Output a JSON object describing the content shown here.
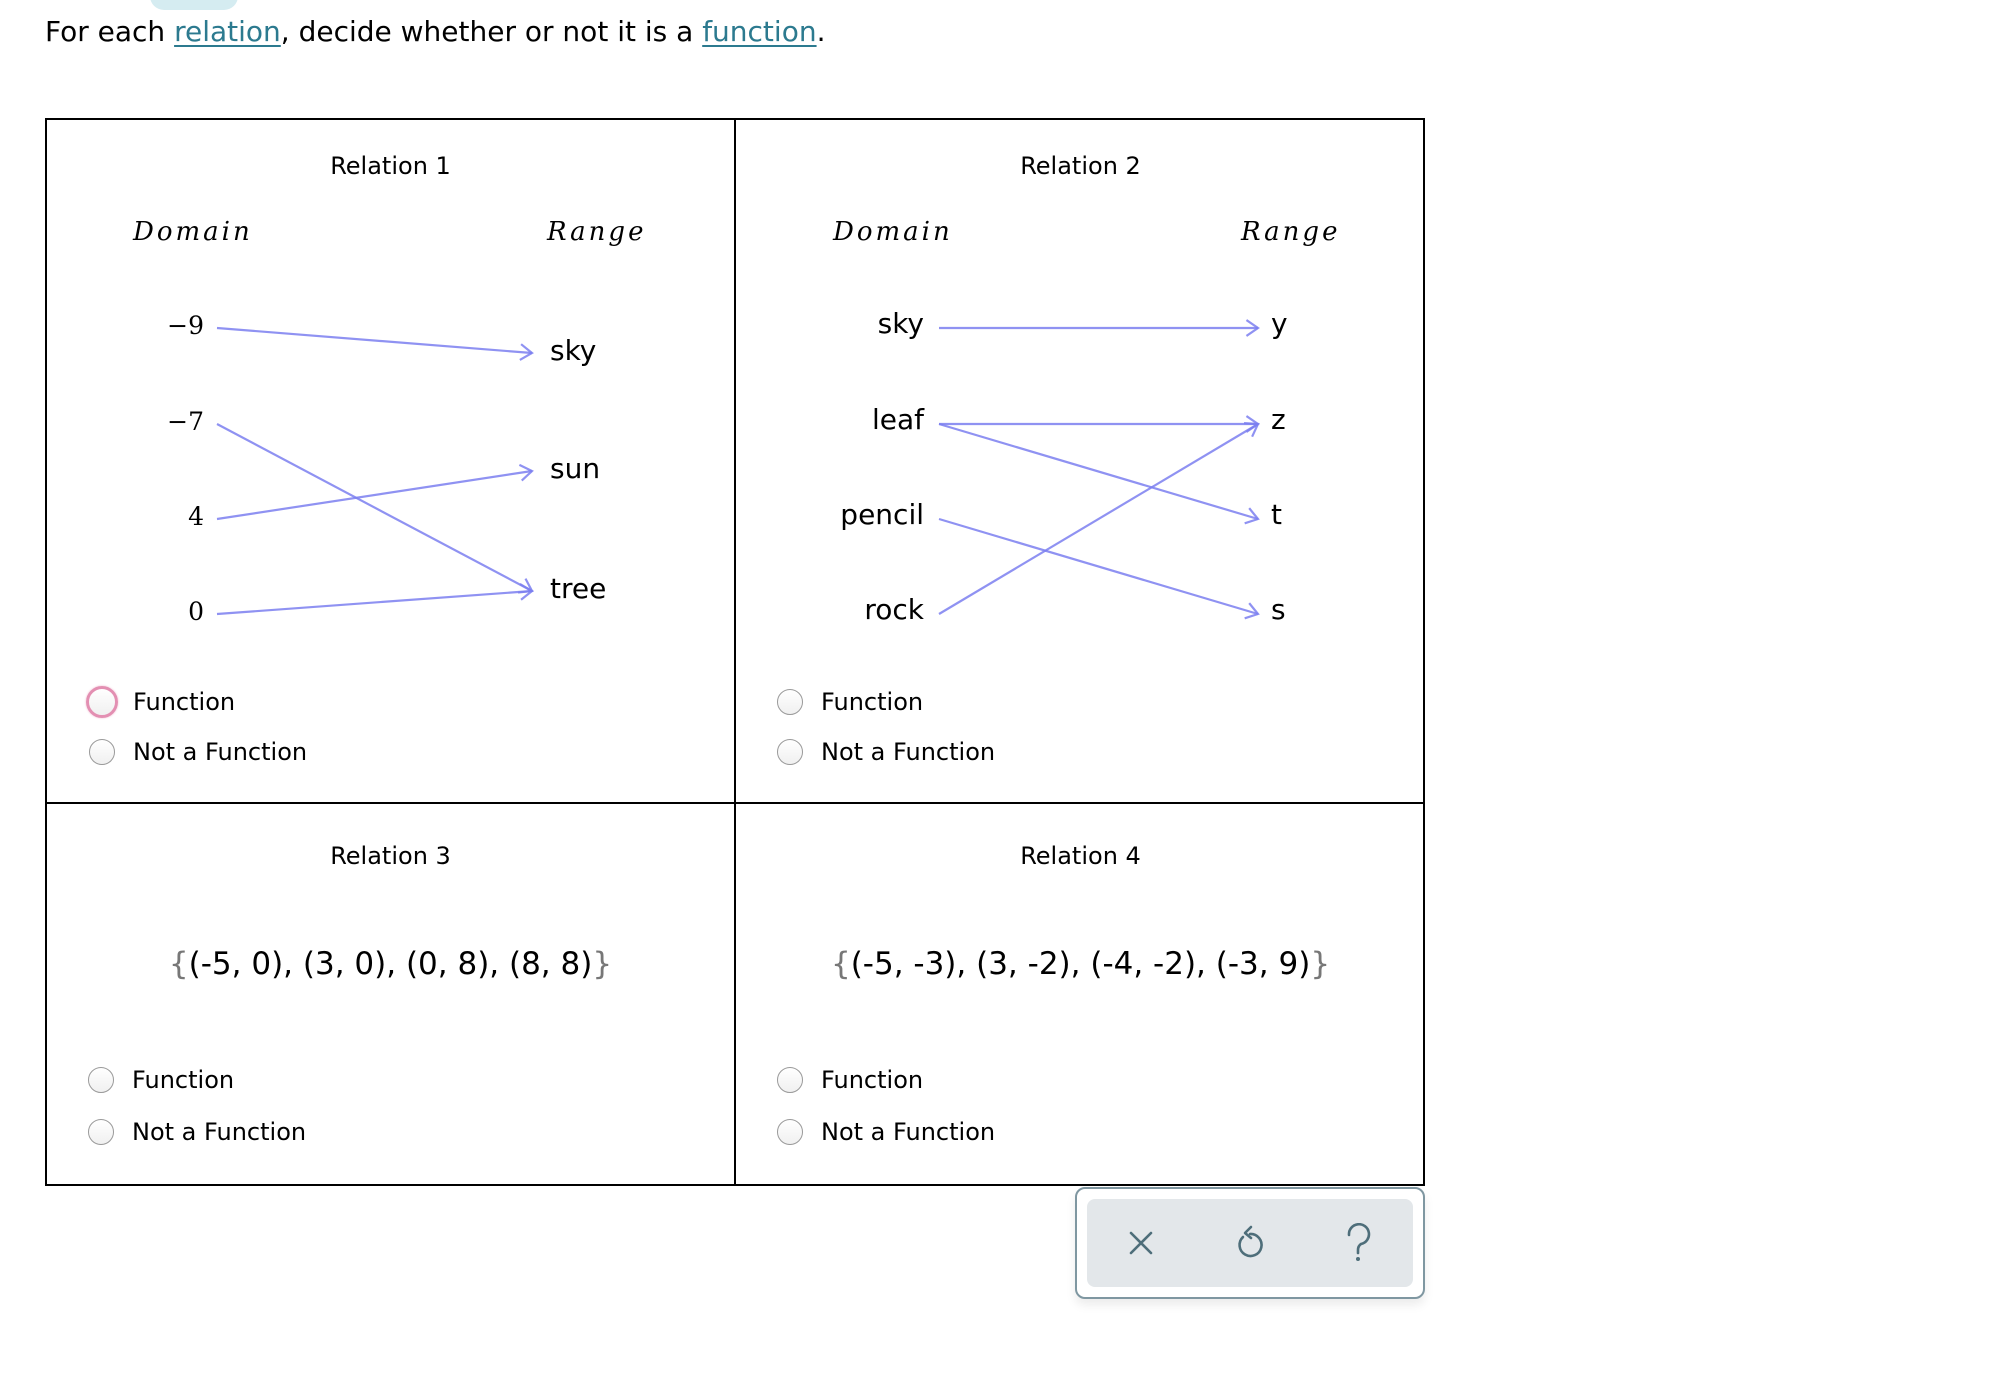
{
  "prompt": {
    "before": "For each ",
    "link1": "relation",
    "middle": ", decide whether or not it is a ",
    "link2": "function",
    "after": "."
  },
  "colors": {
    "link": "#2c7a8f",
    "arrow": "#7b7ff0",
    "focus_ring": "#e38fb2",
    "toolbar_icon": "#4e6e7a"
  },
  "relations": [
    {
      "title": "Relation 1",
      "domain_label": "Domain",
      "range_label": "Range",
      "domain": [
        "−9",
        "−7",
        "4",
        "0"
      ],
      "range": [
        "sky",
        "sun",
        "tree"
      ],
      "mappings": [
        [
          0,
          0
        ],
        [
          1,
          2
        ],
        [
          2,
          1
        ],
        [
          3,
          2
        ]
      ],
      "options": [
        "Function",
        "Not a Function"
      ],
      "focused_option": 0
    },
    {
      "title": "Relation 2",
      "domain_label": "Domain",
      "range_label": "Range",
      "domain": [
        "sky",
        "leaf",
        "pencil",
        "rock"
      ],
      "range": [
        "y",
        "z",
        "t",
        "s"
      ],
      "mappings": [
        [
          0,
          0
        ],
        [
          1,
          1
        ],
        [
          1,
          2
        ],
        [
          2,
          3
        ],
        [
          3,
          1
        ]
      ],
      "options": [
        "Function",
        "Not a Function"
      ]
    },
    {
      "title": "Relation 3",
      "set_open": "{",
      "set_body": "(-5, 0), (3, 0), (0, 8), (8, 8)",
      "set_close": "}",
      "options": [
        "Function",
        "Not a Function"
      ]
    },
    {
      "title": "Relation 4",
      "set_open": "{",
      "set_body": "(-5, -3), (3, -2), (-4, -2), (-3, 9)",
      "set_close": "}",
      "options": [
        "Function",
        "Not a Function"
      ]
    }
  ],
  "toolbar": {
    "buttons": [
      "close",
      "undo",
      "help"
    ],
    "help_glyph": "?"
  }
}
